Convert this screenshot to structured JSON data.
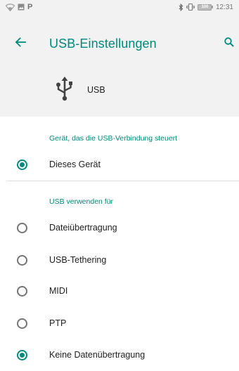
{
  "status_bar": {
    "icons_left": [
      "wifi-icon",
      "image-icon",
      "p-app-icon"
    ],
    "p_glyph": "P",
    "icons_right": [
      "bluetooth-icon",
      "vibrate-icon",
      "battery-icon"
    ],
    "battery_level": "100",
    "time": "12:31"
  },
  "app_bar": {
    "title": "USB-Einstellungen",
    "back_icon": "arrow-left-icon",
    "search_icon": "search-icon"
  },
  "usb_header": {
    "icon": "usb-icon",
    "label": "USB"
  },
  "section_controller": {
    "title": "Gerät, das die USB-Verbindung steuert",
    "options": [
      {
        "label": "Dieses Gerät",
        "checked": true
      }
    ]
  },
  "section_use": {
    "title": "USB verwenden für",
    "options": [
      {
        "label": "Dateiübertragung",
        "checked": false
      },
      {
        "label": "USB-Tethering",
        "checked": false
      },
      {
        "label": "MIDI",
        "checked": false
      },
      {
        "label": "PTP",
        "checked": false
      },
      {
        "label": "Keine Datenübertragung",
        "checked": true
      }
    ]
  },
  "colors": {
    "accent": "#00897b",
    "header_bg": "#f2f2f2",
    "text": "#212121",
    "radio_off": "#757575"
  }
}
